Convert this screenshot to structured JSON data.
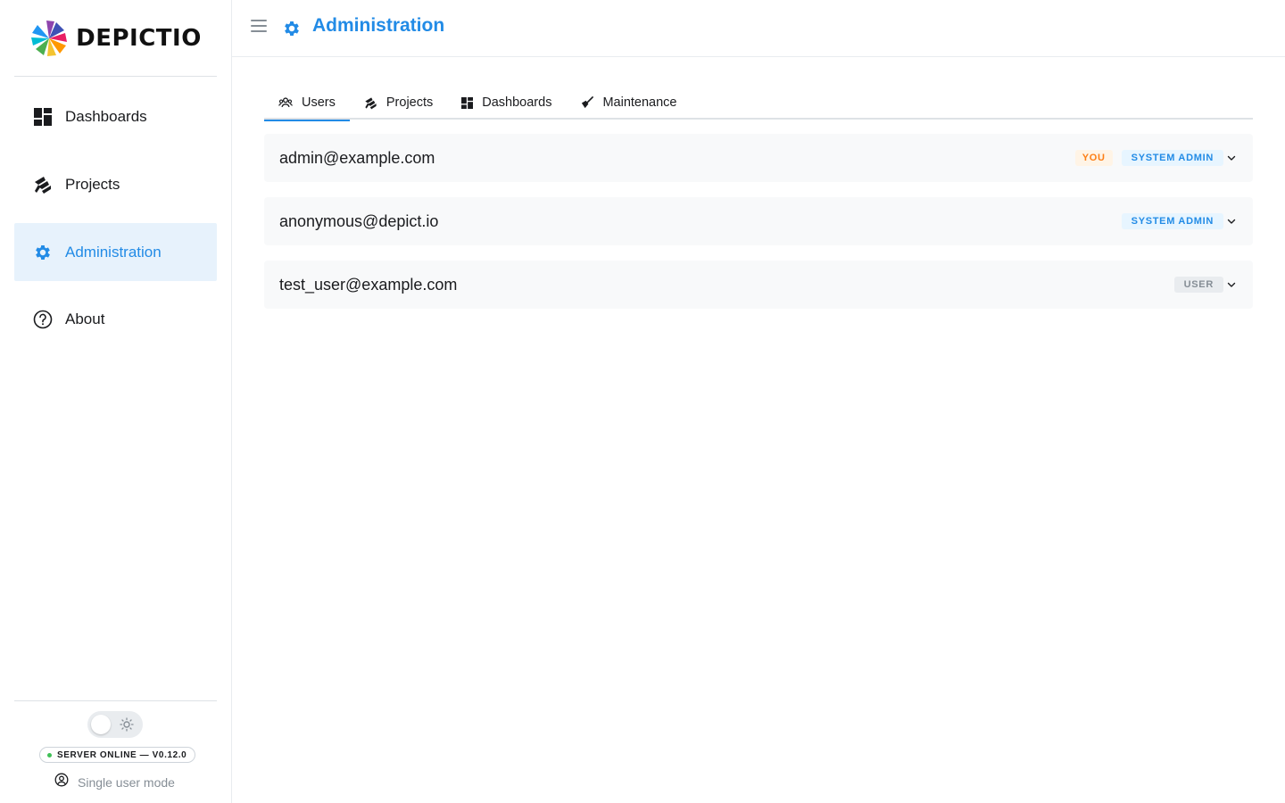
{
  "app": {
    "name": "DEPICTIO"
  },
  "sidebar": {
    "items": [
      {
        "label": "Dashboards",
        "icon": "dashboard-icon",
        "active": false
      },
      {
        "label": "Projects",
        "icon": "projects-icon",
        "active": false
      },
      {
        "label": "Administration",
        "icon": "gear-icon",
        "active": true
      },
      {
        "label": "About",
        "icon": "help-circle-icon",
        "active": false
      }
    ],
    "footer": {
      "theme_toggle": {
        "state": "light",
        "icon": "sun-icon"
      },
      "server_status": "SERVER ONLINE — V0.12.0",
      "server_status_color": "#40c057",
      "user_mode": "Single user mode"
    }
  },
  "header": {
    "title": "Administration",
    "icon": "gear-icon",
    "accent": "#228be6"
  },
  "tabs": [
    {
      "label": "Users",
      "icon": "users-icon",
      "active": true
    },
    {
      "label": "Projects",
      "icon": "projects-icon",
      "active": false
    },
    {
      "label": "Dashboards",
      "icon": "dashboard-icon",
      "active": false
    },
    {
      "label": "Maintenance",
      "icon": "broom-icon",
      "active": false
    }
  ],
  "users": [
    {
      "email": "admin@example.com",
      "badges": [
        "YOU",
        "SYSTEM ADMIN"
      ]
    },
    {
      "email": "anonymous@depict.io",
      "badges": [
        "SYSTEM ADMIN"
      ]
    },
    {
      "email": "test_user@example.com",
      "badges": [
        "USER"
      ]
    }
  ]
}
